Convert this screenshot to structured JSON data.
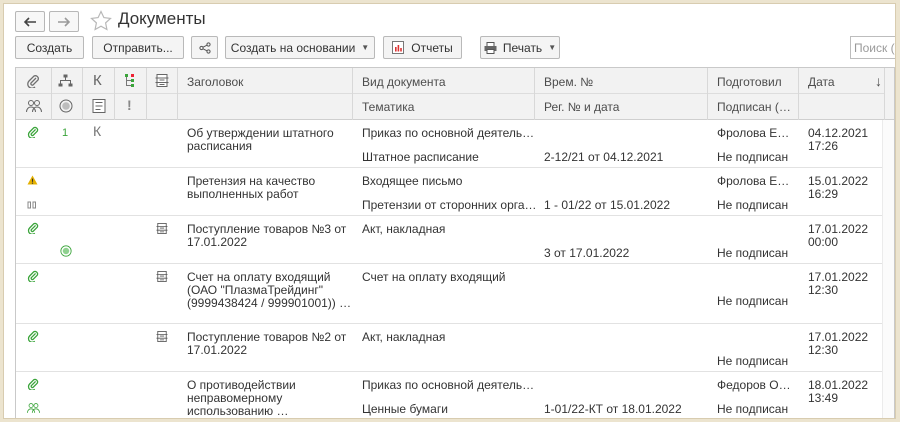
{
  "window": {
    "title": "Документы"
  },
  "toolbar": {
    "create": "Создать",
    "send": "Отправить...",
    "create_based": "Создать на основании",
    "reports": "Отчеты",
    "print": "Печать",
    "search_placeholder": "Поиск (Ctrl+F)"
  },
  "table": {
    "headers": {
      "title": "Заголовок",
      "doc_type": "Вид документа",
      "time_number": "Врем. №",
      "prepared": "Подготовил",
      "date": "Дата",
      "topic": "Тематика",
      "reg": "Рег. № и дата",
      "signed": "Подписан (…",
      "k": "К",
      "exclam": "!",
      "sort_arrow": "↓"
    },
    "rows": [
      {
        "num": "1",
        "k": "К",
        "title": "Об утверждении штатного расписания",
        "doc_type": "Приказ по основной деятель…",
        "topic": "Штатное расписание",
        "reg": "2-12/21 от 04.12.2021",
        "prepared": "Фролова Е…",
        "signed": "Не подписан",
        "date": "04.12.2021 17:26"
      },
      {
        "title": "Претензия на качество выполненных работ",
        "doc_type": "Входящее письмо",
        "topic": "Претензии от сторонних орга…",
        "reg": "1 - 01/22 от 15.01.2022",
        "prepared": "Фролова Е…",
        "signed": "Не подписан",
        "date": "15.01.2022 16:29"
      },
      {
        "title": "Поступление товаров №3 от 17.01.2022",
        "doc_type": "Акт, накладная",
        "topic": "",
        "reg": "3 от 17.01.2022",
        "prepared": "",
        "signed": "Не подписан",
        "date": "17.01.2022 00:00"
      },
      {
        "title": "Счет на оплату входящий (ОАО \"ПлазмаТрейдинг\" (9999438424 / 999901001)) …",
        "doc_type": "Счет на оплату входящий",
        "topic": "",
        "reg": "",
        "prepared": "",
        "signed": "Не подписан",
        "date": "17.01.2022 12:30"
      },
      {
        "title": "Поступление товаров №2 от 17.01.2022",
        "doc_type": "Акт, накладная",
        "topic": "",
        "reg": "",
        "prepared": "",
        "signed": "Не подписан",
        "date": "17.01.2022 12:30"
      },
      {
        "title": "О противодействии неправомерному использованию …",
        "doc_type": "Приказ по основной деятель…",
        "topic": "Ценные бумаги",
        "reg": "1-01/22-КТ от 18.01.2022",
        "prepared": "Федоров О…",
        "signed": "Не подписан",
        "date": "18.01.2022 13:49"
      }
    ]
  },
  "colors": {
    "accent": "#3aa43a",
    "warning": "#e4b000"
  }
}
